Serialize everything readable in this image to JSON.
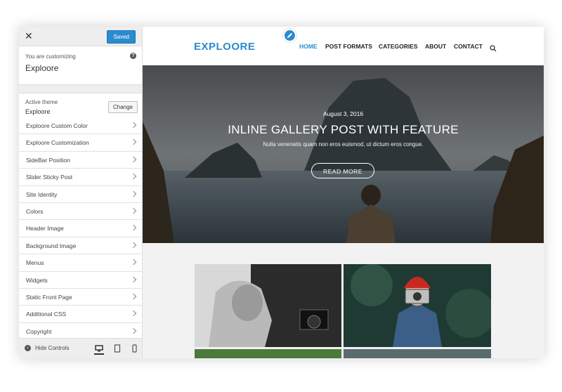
{
  "sidebar": {
    "close_icon": "close-icon",
    "saved_label": "Saved",
    "customizing_label": "You are customizing",
    "site_name": "Exploore",
    "help_icon": "help-icon",
    "active_theme_label": "Active theme",
    "theme_name": "Exploore",
    "change_label": "Change",
    "panels": [
      {
        "label": "Exploore Custom Color"
      },
      {
        "label": "Exploore Customization"
      },
      {
        "label": "SideBar Position"
      },
      {
        "label": "Slider Sticky Post"
      },
      {
        "label": "Site Identity"
      },
      {
        "label": "Colors"
      },
      {
        "label": "Header Image"
      },
      {
        "label": "Background Image"
      },
      {
        "label": "Menus"
      },
      {
        "label": "Widgets"
      },
      {
        "label": "Static Front Page"
      },
      {
        "label": "Additional CSS"
      },
      {
        "label": "Copyright"
      }
    ],
    "footer": {
      "hide_label": "Hide Controls",
      "devices": [
        "desktop-icon",
        "tablet-icon",
        "mobile-icon"
      ],
      "active_device": "desktop-icon"
    }
  },
  "preview": {
    "logo": "EXPLOORE",
    "nav": [
      {
        "label": "HOME",
        "active": true
      },
      {
        "label": "POST FORMATS",
        "active": false
      },
      {
        "label": "CATEGORIES",
        "active": false
      },
      {
        "label": "ABOUT",
        "active": false
      },
      {
        "label": "CONTACT",
        "active": false
      }
    ],
    "search_icon": "search-icon",
    "hero": {
      "date": "August 3, 2016",
      "title": "INLINE GALLERY POST WITH FEATURE",
      "subtitle": "Nulla venenatis quam non eros euismod, ut dictum eros congue.",
      "button": "READ MORE"
    }
  },
  "colors": {
    "accent": "#2a8ccf"
  }
}
